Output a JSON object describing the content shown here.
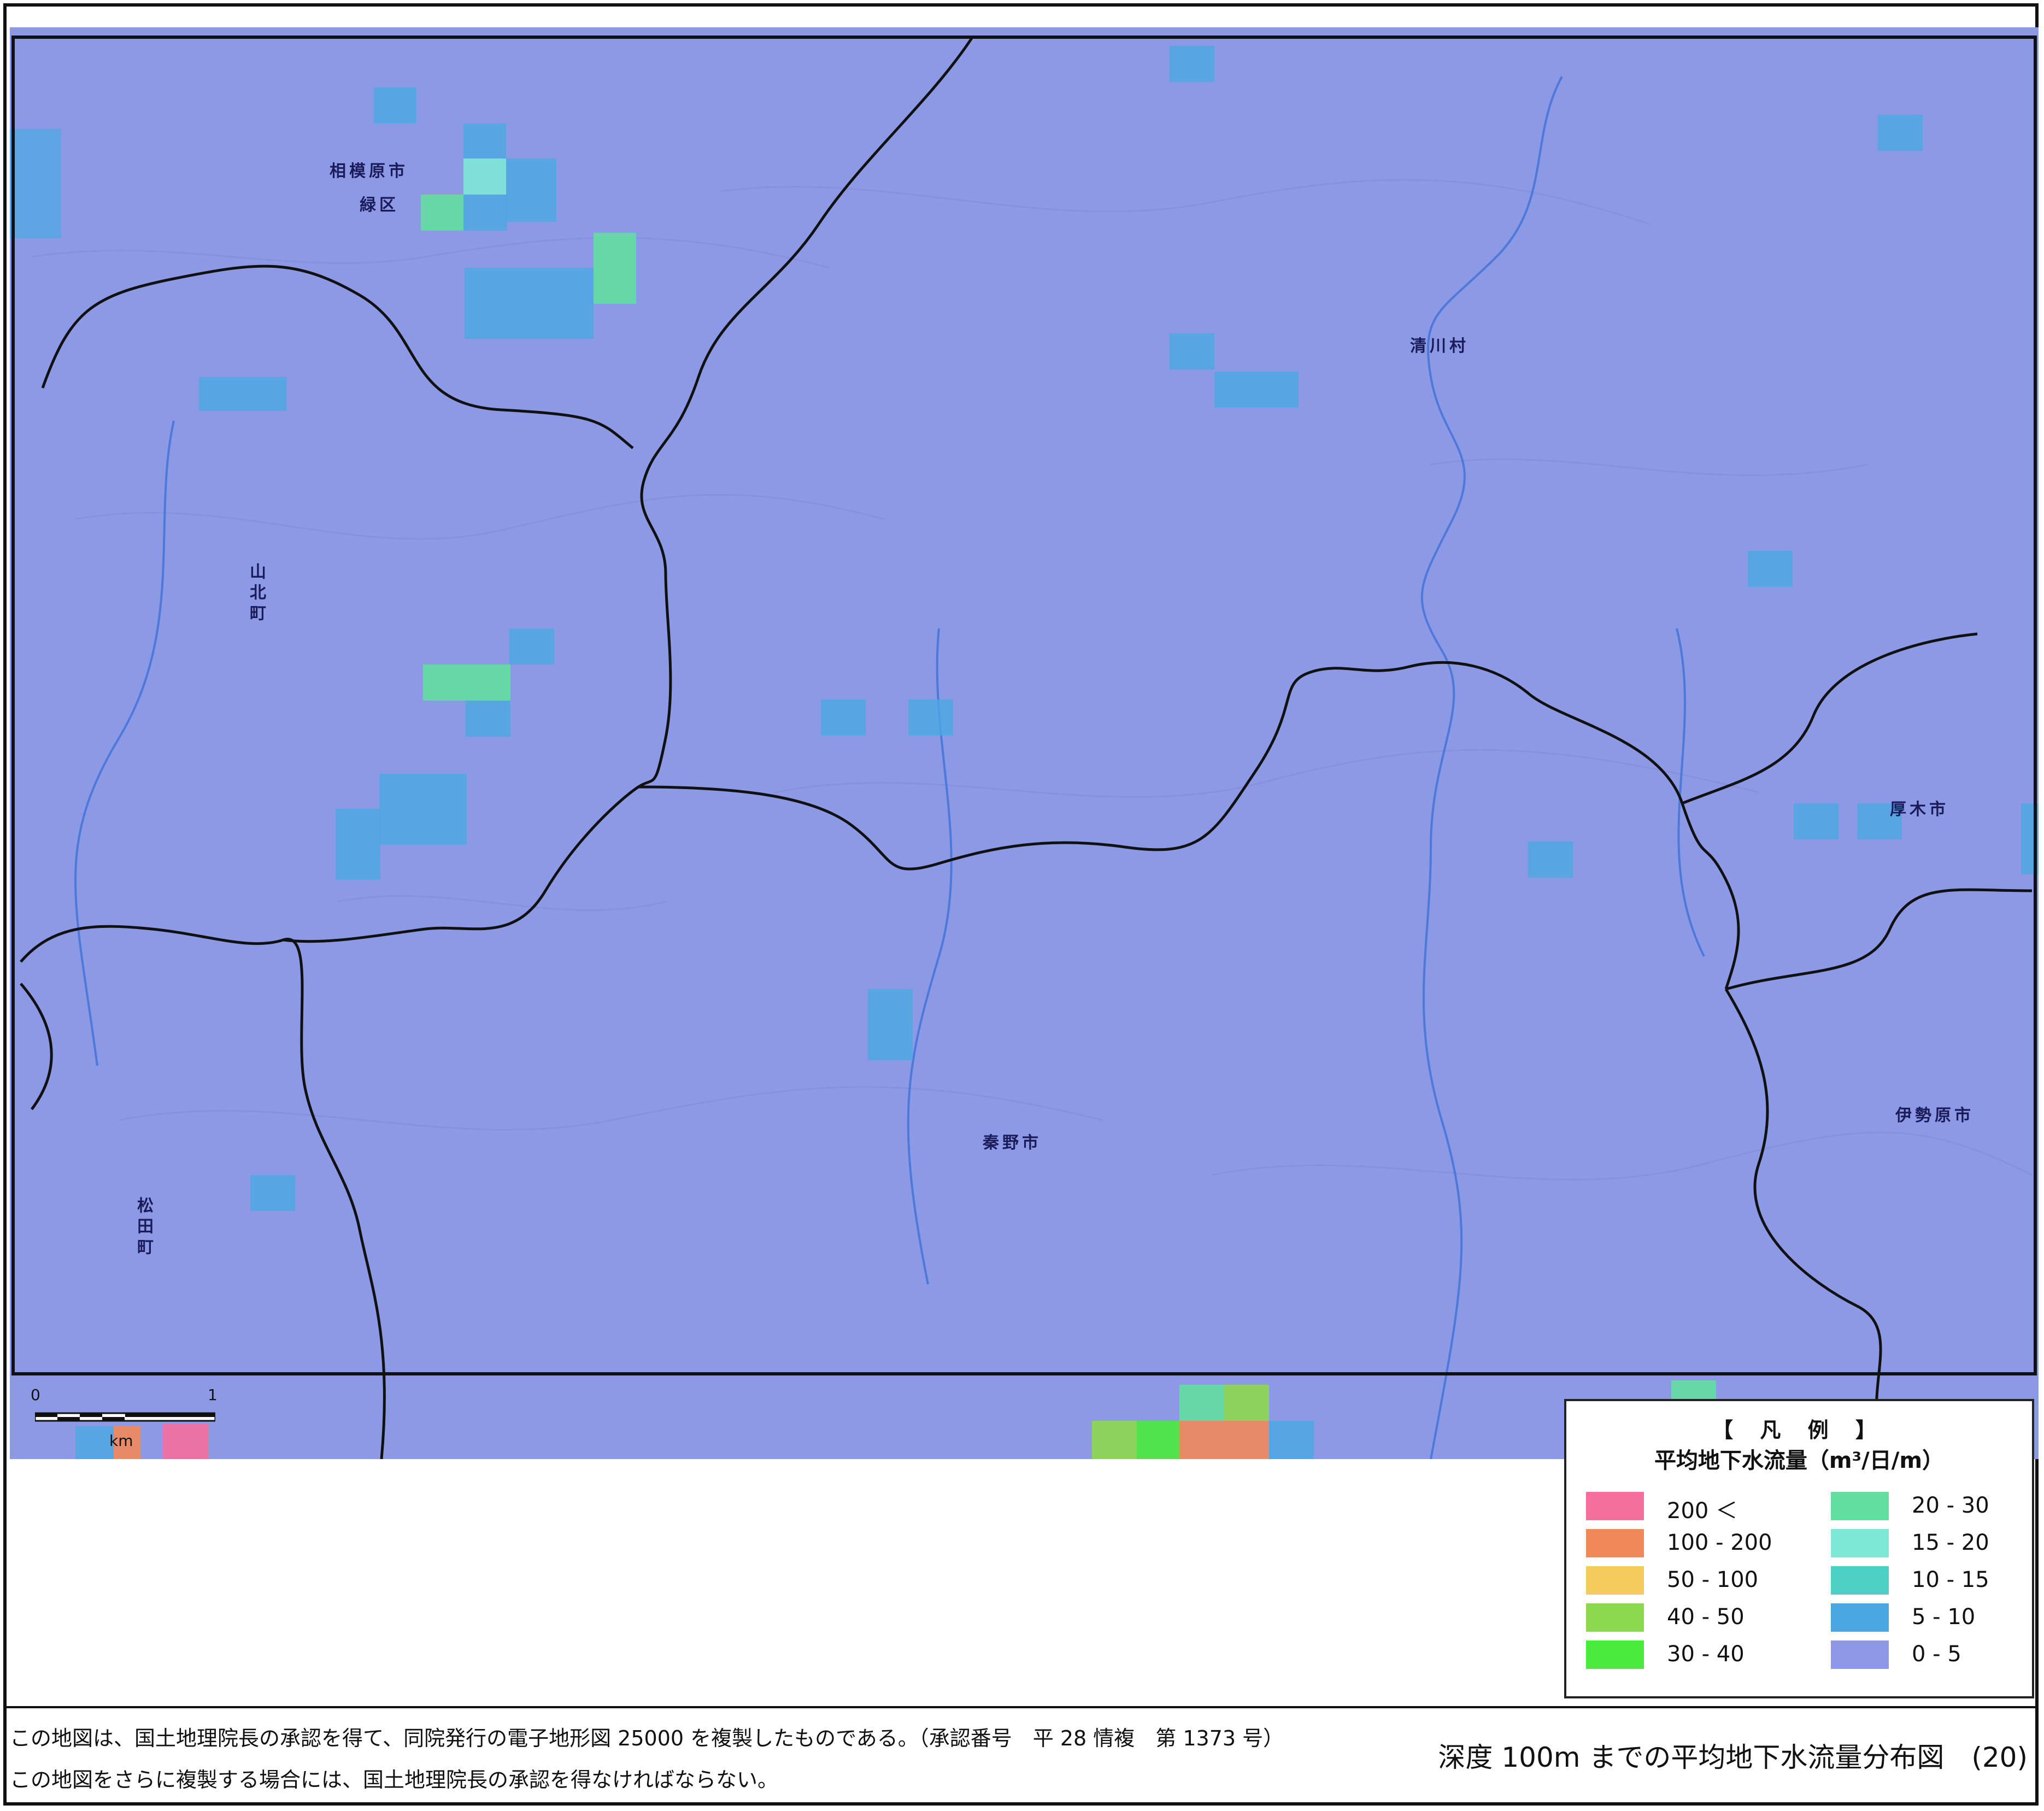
{
  "map": {
    "place_labels": [
      {
        "id": "sagamihara",
        "text": "相模原市"
      },
      {
        "id": "midori",
        "text": "緑区"
      },
      {
        "id": "yamakita",
        "text": "山北町"
      },
      {
        "id": "kiyokawa",
        "text": "清川村"
      },
      {
        "id": "atsugi",
        "text": "厚木市"
      },
      {
        "id": "isehara",
        "text": "伊勢原市"
      },
      {
        "id": "hadano",
        "text": "秦野市"
      },
      {
        "id": "matsuda",
        "text": "松田町"
      }
    ],
    "colors": {
      "base": "#8c9ae6",
      "flow_0_5": "#8e98e6",
      "flow_5_10": "#4aa7e2",
      "flow_10_15": "#4fd0c5",
      "flow_15_20": "#7de8d6",
      "flow_20_30": "#62dea0",
      "flow_30_40": "#4aeb3c",
      "flow_40_50": "#8cd84e",
      "flow_50_100": "#f4cb5c",
      "flow_100_200": "#f0885a",
      "flow_200_plus": "#f46e9c",
      "boundary": "#111111"
    }
  },
  "scale": {
    "zero": "0",
    "one": "1",
    "unit": "km"
  },
  "legend": {
    "title": "【 凡 例 】",
    "subtitle": "平均地下水流量（m³/日/m）",
    "items": [
      {
        "label": "200 ＜",
        "color": "#f46e9c"
      },
      {
        "label": "100 - 200",
        "color": "#f0885a"
      },
      {
        "label": "50 - 100",
        "color": "#f4cb5c"
      },
      {
        "label": "40 - 50",
        "color": "#8cd84e"
      },
      {
        "label": "30 - 40",
        "color": "#4aeb3c"
      },
      {
        "label": "20 - 30",
        "color": "#62dea0"
      },
      {
        "label": "15 - 20",
        "color": "#7de8d6"
      },
      {
        "label": "10 - 15",
        "color": "#4fd0c5"
      },
      {
        "label": "5 - 10",
        "color": "#4aa7e2"
      },
      {
        "label": "0 - 5",
        "color": "#8e98e6"
      }
    ]
  },
  "footer": {
    "note1": "この地図は、国土地理院長の承認を得て、同院発行の電子地形図 25000 を複製したものである。（承認番号　平 28 情複　第 1373 号）",
    "note2": "この地図をさらに複製する場合には、国土地理院長の承認を得なければならない。",
    "title": "深度 100m までの平均地下水流量分布図　(20)"
  }
}
